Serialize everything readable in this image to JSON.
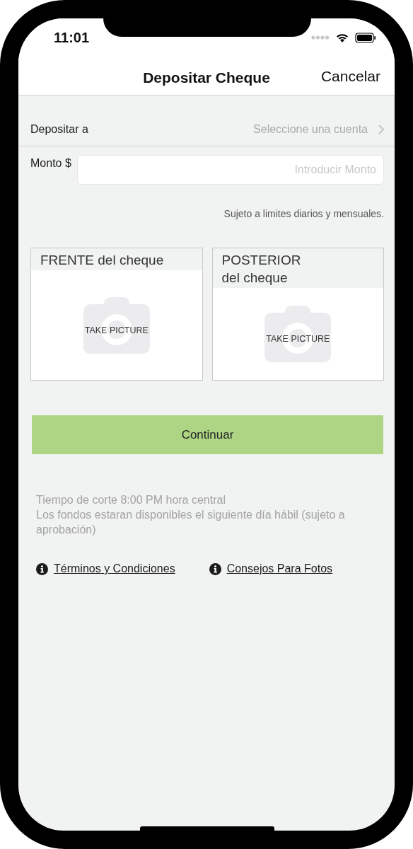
{
  "status_bar": {
    "time": "11:01"
  },
  "nav": {
    "title": "Depositar Cheque",
    "cancel": "Cancelar"
  },
  "account_row": {
    "label": "Depositar a",
    "placeholder": "Seleccione una cuenta"
  },
  "amount": {
    "label": "Monto $",
    "placeholder": "Introducir Monto"
  },
  "limit_note": "Sujeto a limites diarios y mensuales.",
  "photo_cards": [
    {
      "title": "FRENTE del cheque",
      "action": "TAKE PICTURE"
    },
    {
      "title": "POSTERIOR\ndel cheque",
      "action": "TAKE PICTURE"
    }
  ],
  "continue_button": "Continuar",
  "info_lines": [
    "Tiempo de corte 8:00 PM hora central",
    "Los fondos estaran disponibles el siguiente día hábil (sujeto a aprobación)"
  ],
  "links": [
    "Términos y Condiciones",
    "Consejos Para Fotos"
  ]
}
